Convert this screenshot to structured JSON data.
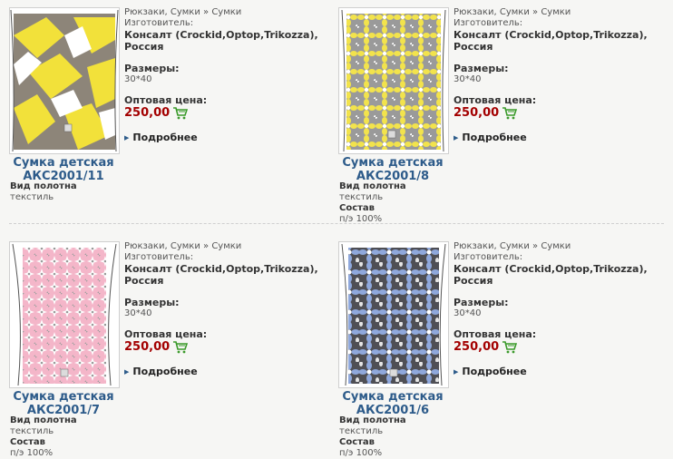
{
  "products": [
    {
      "category_1": "Рюкзаки",
      "category_2": "Сумки",
      "category_3": "Сумки",
      "manufacturer_label": "Изготовитель:",
      "manufacturer_value": "Консалт (Crockid,Optop,Trikozza), Россия",
      "size_label": "Размеры:",
      "size_value": "30*40",
      "price_label": "Оптовая цена:",
      "price_value": "250,00",
      "more_label": "Подробнее",
      "title_line1": "Сумка детская",
      "title_line2": "АКС2001/11",
      "fabric_label": "Вид полотна",
      "fabric_value": "текстиль",
      "pattern": "yellow-gray-geometric"
    },
    {
      "category_1": "Рюкзаки",
      "category_2": "Сумки",
      "category_3": "Сумки",
      "manufacturer_label": "Изготовитель:",
      "manufacturer_value": "Консалт (Crockid,Optop,Trikozza), Россия",
      "size_label": "Размеры:",
      "size_value": "30*40",
      "price_label": "Оптовая цена:",
      "price_value": "250,00",
      "more_label": "Подробнее",
      "title_line1": "Сумка детская",
      "title_line2": "АКС2001/8",
      "fabric_label": "Вид полотна",
      "fabric_value": "текстиль",
      "composition_label": "Состав",
      "composition_value": "п/э 100%",
      "pattern": "yellow-gray-floral"
    },
    {
      "category_1": "Рюкзаки",
      "category_2": "Сумки",
      "category_3": "Сумки",
      "manufacturer_label": "Изготовитель:",
      "manufacturer_value": "Консалт (Crockid,Optop,Trikozza), Россия",
      "size_label": "Размеры:",
      "size_value": "30*40",
      "price_label": "Оптовая цена:",
      "price_value": "250,00",
      "more_label": "Подробнее",
      "title_line1": "Сумка детская",
      "title_line2": "АКС2001/7",
      "fabric_label": "Вид полотна",
      "fabric_value": "текстиль",
      "composition_label": "Состав",
      "composition_value": "п/э 100%",
      "pattern": "pink-white-kaleidoscope"
    },
    {
      "category_1": "Рюкзаки",
      "category_2": "Сумки",
      "category_3": "Сумки",
      "manufacturer_label": "Изготовитель:",
      "manufacturer_value": "Консалт (Crockid,Optop,Trikozza), Россия",
      "size_label": "Размеры:",
      "size_value": "30*40",
      "price_label": "Оптовая цена:",
      "price_value": "250,00",
      "more_label": "Подробнее",
      "title_line1": "Сумка детская",
      "title_line2": "АКС2001/6",
      "fabric_label": "Вид полотна",
      "fabric_value": "текстиль",
      "composition_label": "Состав",
      "composition_value": "п/э 100%",
      "pattern": "blue-gray-floral"
    }
  ],
  "colors": {
    "price": "#a30000",
    "title_link": "#2d5b8a",
    "cart_green": "#3a9a2a"
  },
  "icons": {
    "cart": "shopping-cart-icon",
    "arrow": "triangle-right-icon"
  }
}
